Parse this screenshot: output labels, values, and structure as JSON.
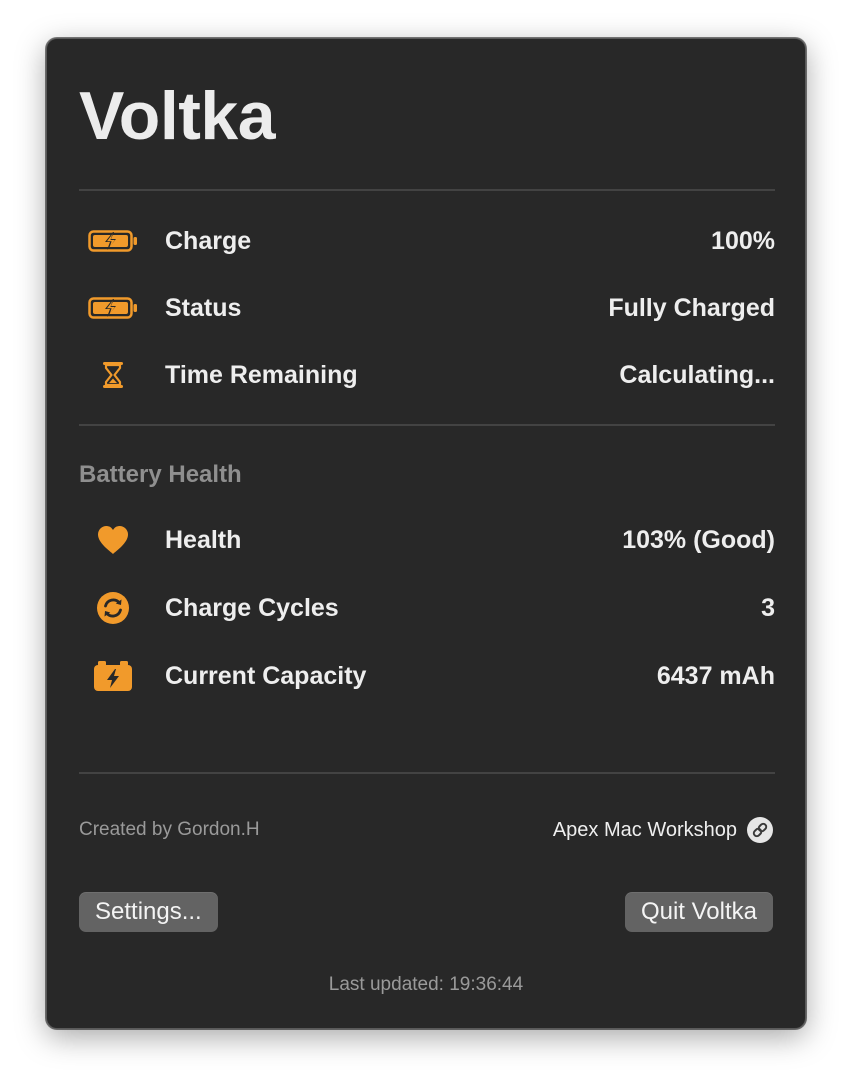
{
  "app": {
    "title": "Voltka"
  },
  "colors": {
    "accent": "#F19A2B",
    "background": "#282828",
    "divider": "#434343",
    "button": "#636363"
  },
  "status_rows": [
    {
      "icon": "battery-charging-icon",
      "label": "Charge",
      "value": "100%"
    },
    {
      "icon": "battery-charging-icon",
      "label": "Status",
      "value": "Fully Charged"
    },
    {
      "icon": "hourglass-icon",
      "label": "Time Remaining",
      "value": "Calculating..."
    }
  ],
  "health_section": {
    "title": "Battery Health",
    "rows": [
      {
        "icon": "heart-icon",
        "label": "Health",
        "value": "103% (Good)"
      },
      {
        "icon": "cycle-arrows-icon",
        "label": "Charge Cycles",
        "value": "3"
      },
      {
        "icon": "car-battery-icon",
        "label": "Current Capacity",
        "value": "6437 mAh"
      }
    ]
  },
  "footer": {
    "credit": "Created by Gordon.H",
    "link_text": "Apex Mac Workshop",
    "link_icon": "link-icon"
  },
  "buttons": {
    "settings": "Settings...",
    "quit": "Quit Voltka"
  },
  "last_updated": "Last updated: 19:36:44"
}
